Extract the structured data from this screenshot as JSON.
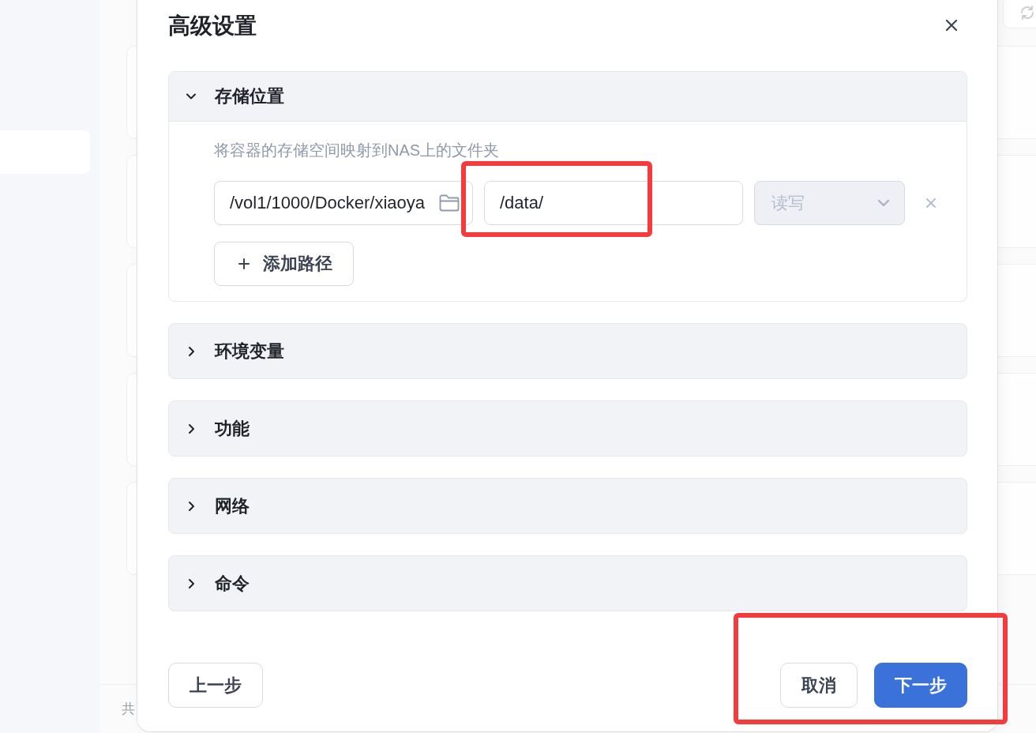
{
  "background": {
    "footer_text": "共"
  },
  "dialog": {
    "title": "高级设置"
  },
  "sections": [
    {
      "title": "存储位置",
      "expanded": true,
      "description": "将容器的存储空间映射到NAS上的文件夹",
      "mounts": [
        {
          "host_path": "/vol1/1000/Docker/xiaoya",
          "container_path": "/data/",
          "container_highlighted": true,
          "mode": "读写",
          "mode_disabled": true
        }
      ],
      "add_button": "添加路径"
    },
    {
      "title": "环境变量",
      "expanded": false
    },
    {
      "title": "功能",
      "expanded": false
    },
    {
      "title": "网络",
      "expanded": false
    },
    {
      "title": "命令",
      "expanded": false
    }
  ],
  "footer": {
    "back_button": "上一步",
    "cancel_button": "取消",
    "next_button": "下一步",
    "actions_highlighted": true
  }
}
